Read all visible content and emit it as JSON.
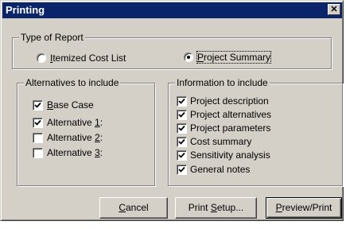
{
  "window": {
    "title": "Printing",
    "close_glyph": "✕"
  },
  "report_type": {
    "legend": "Type of Report",
    "options": [
      {
        "pre": "",
        "key": "I",
        "post": "temized Cost List",
        "selected": false
      },
      {
        "pre": "",
        "key": "P",
        "post": "roject Summary",
        "selected": true
      }
    ]
  },
  "alternatives": {
    "legend": "Alternatives to include",
    "items": [
      {
        "pre": "",
        "key": "B",
        "post": "ase Case",
        "checked": true
      },
      {
        "pre": "Alternative ",
        "key": "1",
        "post": ":",
        "checked": true
      },
      {
        "pre": "Alternative ",
        "key": "2",
        "post": ":",
        "checked": false
      },
      {
        "pre": "Alternative ",
        "key": "3",
        "post": ":",
        "checked": false
      }
    ]
  },
  "information": {
    "legend": "Information to include",
    "items": [
      {
        "label": "Project description",
        "checked": true
      },
      {
        "label": "Project alternatives",
        "checked": true
      },
      {
        "label": "Project parameters",
        "checked": true
      },
      {
        "label": "Cost summary",
        "checked": true
      },
      {
        "label": "Sensitivity analysis",
        "checked": true
      },
      {
        "label": "General notes",
        "checked": true
      }
    ]
  },
  "buttons": {
    "cancel": {
      "pre": "",
      "key": "C",
      "post": "ancel"
    },
    "print_setup": {
      "pre": "Print ",
      "key": "S",
      "post": "etup..."
    },
    "preview": {
      "pre": "",
      "key": "P",
      "post": "review/Print"
    }
  },
  "colors": {
    "titlebar": "#0a246a",
    "face": "#d4d0c8"
  }
}
